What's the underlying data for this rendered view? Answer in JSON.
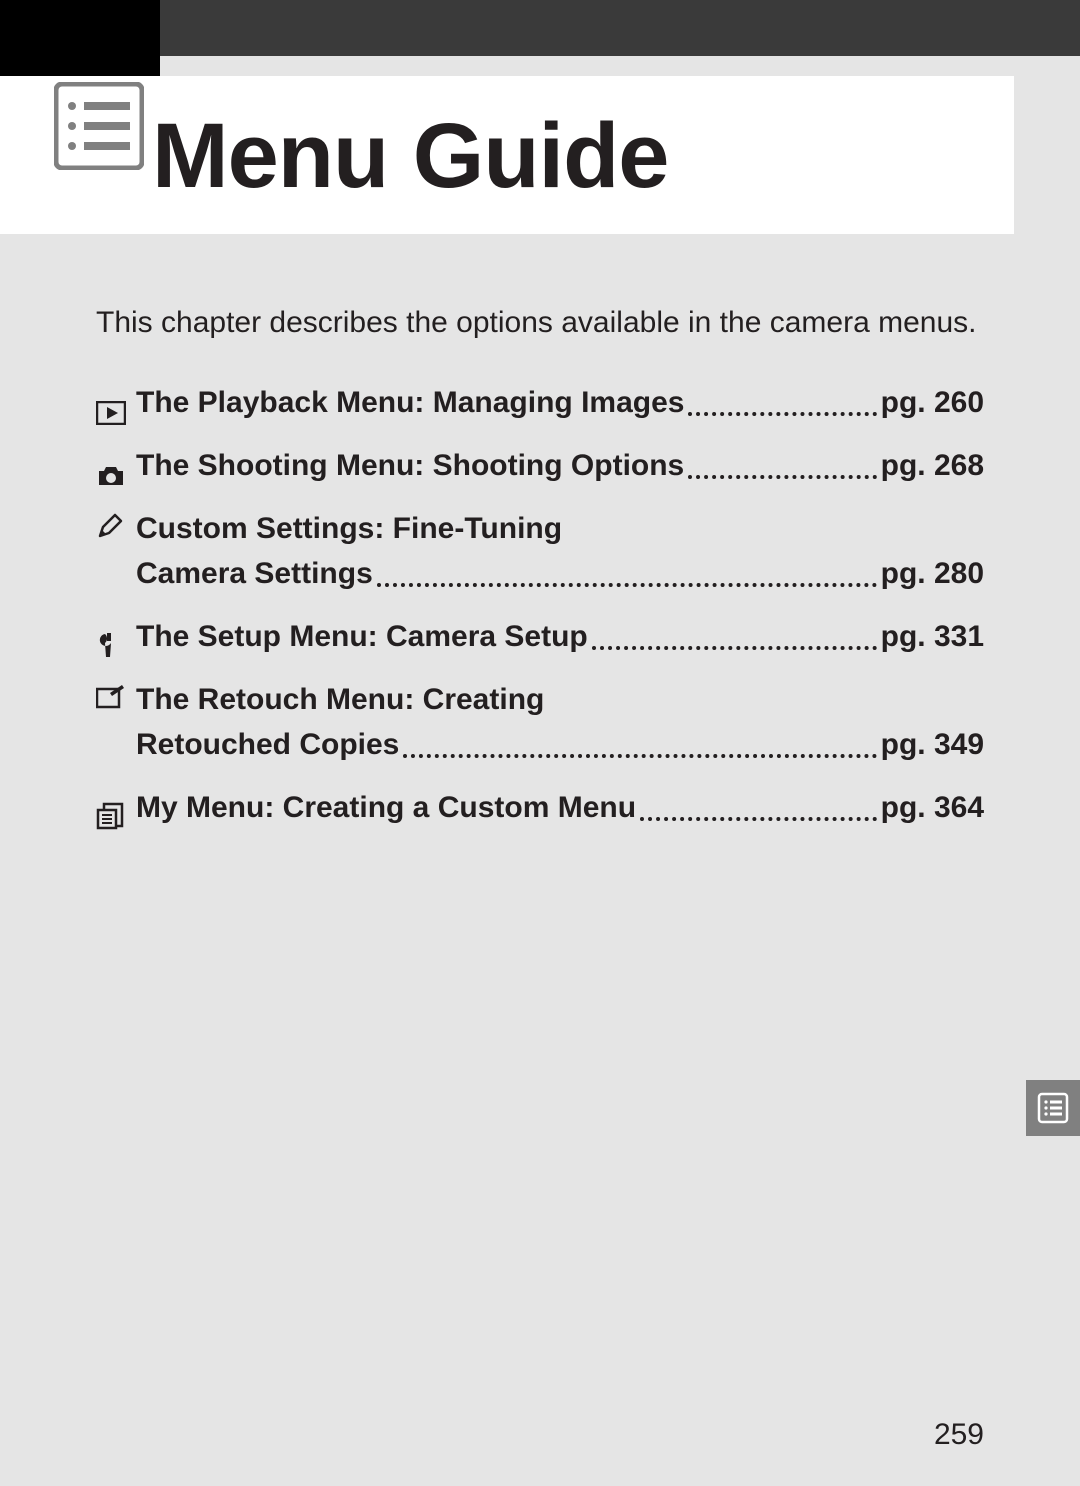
{
  "title": "Menu Guide",
  "intro": "This chapter describes the options available in the camera menus.",
  "toc": {
    "items": [
      {
        "title": "The Playback Menu: Managing Images",
        "title2": "",
        "page": "pg. 260"
      },
      {
        "title": "The Shooting Menu: Shooting Options",
        "title2": "",
        "page": "pg. 268"
      },
      {
        "title": "Custom Settings: Fine-Tuning",
        "title2": "Camera Settings",
        "page": "pg. 280"
      },
      {
        "title": "The Setup Menu: Camera Setup",
        "title2": "",
        "page": "pg. 331"
      },
      {
        "title": "The Retouch Menu: Creating",
        "title2": "Retouched Copies",
        "page": "pg. 349"
      },
      {
        "title": "My Menu: Creating a Custom Menu",
        "title2": "",
        "page": "pg. 364"
      }
    ]
  },
  "page_number": "259"
}
